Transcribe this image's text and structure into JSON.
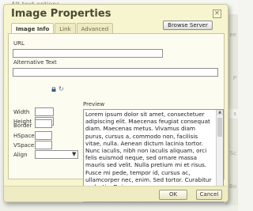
{
  "background": {
    "top_link": "Alt-text options",
    "side_texts": [
      "ee",
      "P",
      "s",
      "Sc",
      "Bo"
    ]
  },
  "dialog": {
    "title": "Image Properties",
    "close_glyph": "✕",
    "tabs": [
      "Image Info",
      "Link",
      "Advanced"
    ],
    "active_tab": "Image Info",
    "url_label": "URL",
    "url_value": "",
    "browse_label": "Browse Server",
    "alt_label": "Alternative Text",
    "alt_value": "",
    "width_label": "Width",
    "width_value": "",
    "height_label": "Height",
    "height_value": "",
    "border_label": "Border",
    "hspace_label": "HSpace",
    "vspace_label": "VSpace",
    "align_label": "Align",
    "align_value": "",
    "reset_glyph": "↻",
    "select_arrow": "▼",
    "preview_label": "Preview",
    "preview_text": "Lorem ipsum dolor sit amet, consectetuer adipiscing elit. Maecenas feugiat consequat diam. Maecenas metus. Vivamus diam purus, cursus a, commodo non, facilisis vitae, nulla. Aenean dictum lacinia tortor. Nunc iaculis, nibh non iaculis aliquam, orci felis euismod neque, sed ornare massa mauris sed velit. Nulla pretium mi et risus. Fusce mi pede, tempor id, cursus ac, ullamcorper nec, enim. Sed tortor. Curabitur molestie. Duis",
    "ok_label": "OK",
    "cancel_label": "Cancel"
  }
}
